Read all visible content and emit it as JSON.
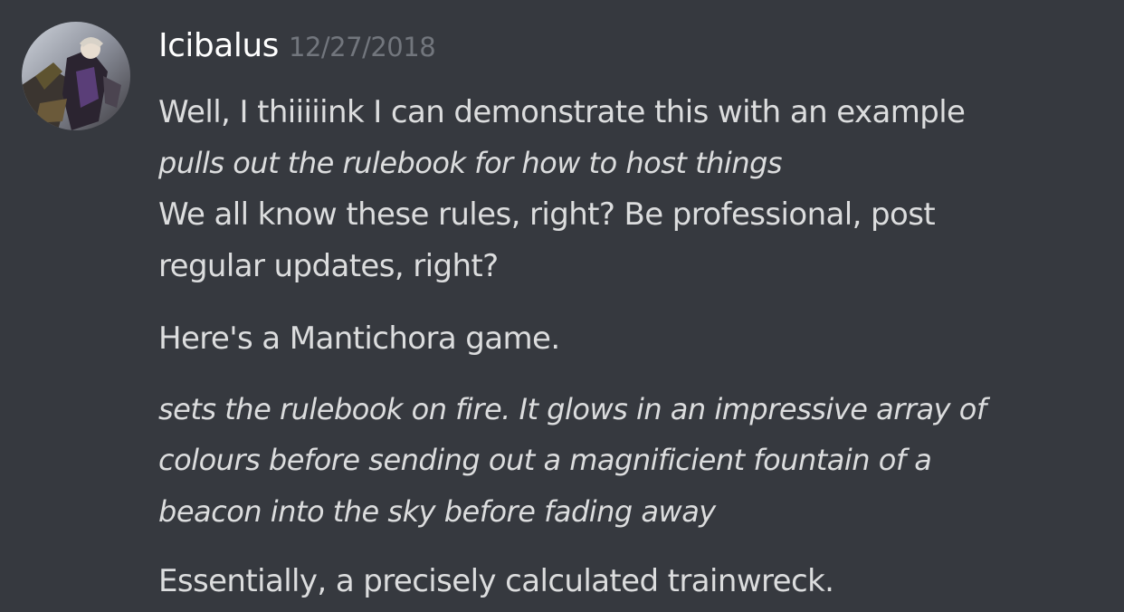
{
  "message": {
    "author": "Icibalus",
    "timestamp": "12/27/2018",
    "avatar_icon": "user-avatar-icon",
    "lines": [
      {
        "text": "Well, I thiiiiink I can demonstrate this with an example",
        "style": "normal"
      },
      {
        "text": "pulls out the rulebook for how to host things",
        "style": "italic"
      },
      {
        "text": "We all know these rules, right? Be professional, post",
        "style": "normal"
      },
      {
        "text": "regular updates, right?",
        "style": "normal"
      },
      {
        "text": "Here's a Mantichora game.",
        "style": "normal"
      },
      {
        "text": "sets the rulebook on fire. It glows in an impressive array of",
        "style": "italic"
      },
      {
        "text": "colours before sending out a magnificient fountain of a",
        "style": "italic"
      },
      {
        "text": "beacon into the sky before fading away",
        "style": "italic"
      },
      {
        "text": "Essentially, a precisely calculated trainwreck.",
        "style": "normal"
      }
    ]
  },
  "colors": {
    "background": "#36393f",
    "username": "#ffffff",
    "timestamp": "#72767d",
    "text": "#dcddde"
  }
}
